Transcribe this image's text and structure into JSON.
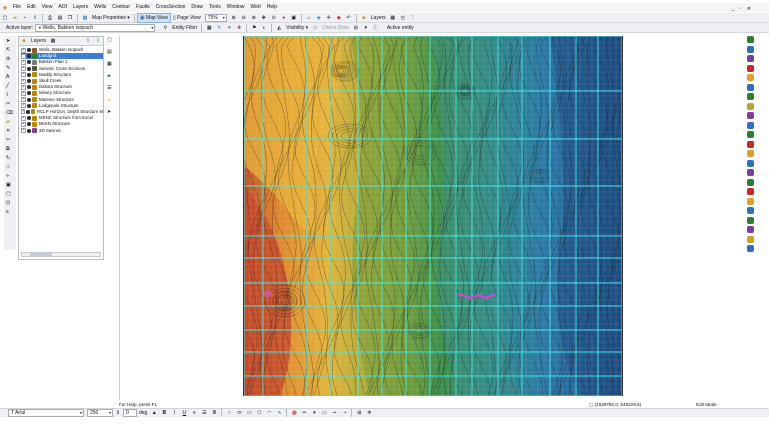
{
  "menubar": {
    "items": [
      "File",
      "Edit",
      "View",
      "AOI",
      "Layers",
      "Wells",
      "Contour",
      "Faults",
      "CrossSection",
      "Draw",
      "Tools",
      "Window",
      "Web",
      "Help"
    ],
    "window_controls": "_ ▫ ✕"
  },
  "toolbar1": {
    "map_properties_label": "Map Properties ▾",
    "map_view_label": "Map View",
    "page_view_label": "Page View",
    "zoom_value": "75%",
    "layers_label": "Layers"
  },
  "toolbar2": {
    "active_layer_label": "Active layer:",
    "active_layer_value": "Wells, Bakken Isopach",
    "entity_filter_label": "Entity Filter",
    "visibility_label": "Visibility ▾",
    "check_dists_label": "Check Dists",
    "active_entity_label": "Active entity"
  },
  "layers_panel": {
    "title": "Layers",
    "items": [
      {
        "label": "Wells, Bakken Isopach",
        "color": "#8a5a2b"
      },
      {
        "label": "Landgrid",
        "color": "#2e7d32",
        "selected": true
      },
      {
        "label": "Bakken Plan 1",
        "color": "#7a7a7a"
      },
      {
        "label": "Seismic Cross Sections",
        "color": "#555555"
      },
      {
        "label": "Muddy Structure",
        "color": "#b8860b"
      },
      {
        "label": "Skull Creek",
        "color": "#b8860b"
      },
      {
        "label": "Dakota Structure",
        "color": "#b8860b"
      },
      {
        "label": "Mowry Structure",
        "color": "#b8860b"
      },
      {
        "label": "Mannen Structure",
        "color": "#b8860b"
      },
      {
        "label": "Lodgepole Structure",
        "color": "#b8860b"
      },
      {
        "label": "RCLP Horizon, Depth Structure M",
        "color": "#b8860b"
      },
      {
        "label": "MSNC Structure from Excel",
        "color": "#b8860b"
      },
      {
        "label": "BKKN Structure",
        "color": "#b8860b"
      },
      {
        "label": "3D Seismic",
        "color": "#7b3fa0"
      }
    ]
  },
  "status": {
    "help_text": "For Help, press F1",
    "coordinates": "(1539780.0, 549229.6)",
    "mode": "Edit Mode"
  },
  "bottom_toolbar": {
    "font_name": "Arial",
    "font_size": "250",
    "angle_value": "0",
    "angle_unit": "deg"
  },
  "colors": {
    "grid_line": "#3ee6e6",
    "selection": "#3d7fd6",
    "highlight_feature": "#e040e0"
  }
}
